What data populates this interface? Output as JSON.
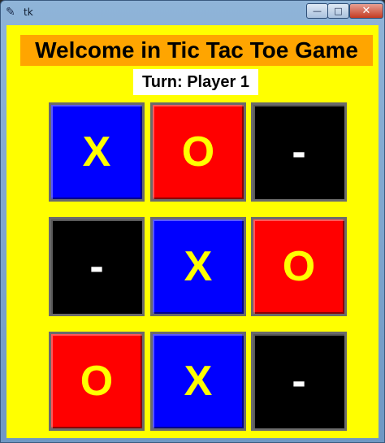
{
  "window": {
    "title": "tk",
    "minimize_glyph": "—",
    "maximize_glyph": "□",
    "close_glyph": "✕",
    "app_icon": "feather-icon"
  },
  "header": {
    "title": "Welcome in Tic Tac Toe Game",
    "turn": "Turn: Player 1"
  },
  "colors": {
    "background": "#ffff00",
    "heading_bg": "#ffa500",
    "x_cell": "#0000ff",
    "o_cell": "#ff0000",
    "empty_cell": "#000000",
    "mark_text": "#ffff00",
    "empty_text": "#ffffff"
  },
  "board": [
    [
      "X",
      "O",
      "-"
    ],
    [
      "-",
      "X",
      "O"
    ],
    [
      "O",
      "X",
      "-"
    ]
  ]
}
